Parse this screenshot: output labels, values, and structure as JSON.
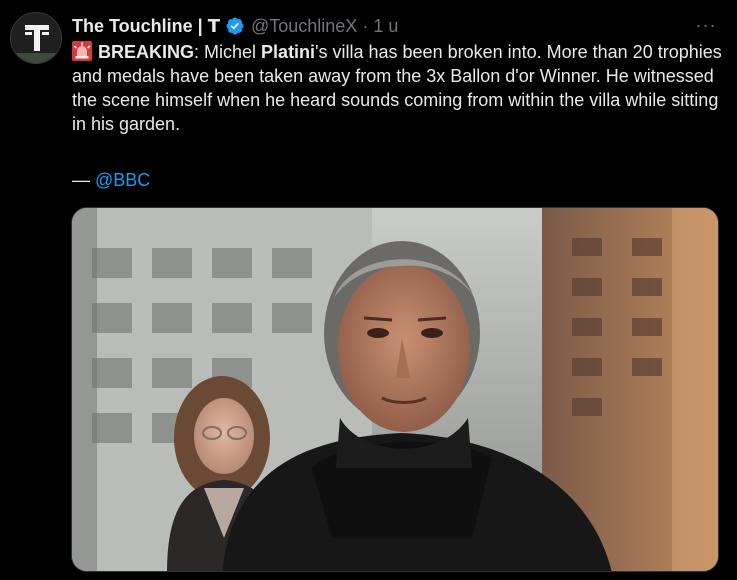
{
  "author": {
    "display_name": "The Touchline | 𝗧",
    "handle": "@TouchlineX",
    "separator": "·",
    "time": "1 u",
    "avatar_icon": "touchline-t-logo-icon",
    "verified_icon": "verified-badge-icon"
  },
  "more_icon": "more-options-icon",
  "more_label": "···",
  "tweet": {
    "siren_icon": "rotating-light-emoji-icon",
    "breaking_label": "BREAKING",
    "part1": ": Michel ",
    "name_bold": "Platini",
    "part2": "'s villa has been broken into. More than 20 trophies and medals have been taken away from the 3x Ballon d'or Winner. He witnessed the scene himself when he heard sounds coming from within the villa while sitting in his garden.",
    "credit_dash": "— ",
    "credit_mention": "@BBC"
  },
  "media": {
    "kind": "photo",
    "subject": "photo-of-michel-platini"
  },
  "colors": {
    "background": "#000000",
    "text": "#e7e9ea",
    "muted": "#71767b",
    "link": "#1d9bf0",
    "verified": "#1d9bf0"
  }
}
